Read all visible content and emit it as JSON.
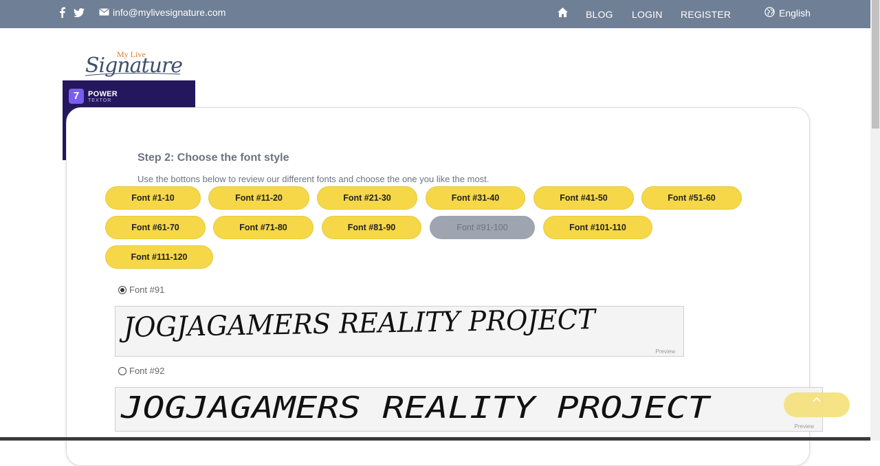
{
  "topbar": {
    "email": "info@mylivesignature.com",
    "nav": [
      "BLOG",
      "LOGIN",
      "REGISTER"
    ],
    "language": "English"
  },
  "logo": {
    "top": "My Live",
    "main": "Signature"
  },
  "ad": {
    "brand": "POWER",
    "sub": "TEXTOR"
  },
  "step": {
    "title": "Step 2: Choose the font style",
    "description": "Use the bottons below to review our different fonts and choose the one you like the most."
  },
  "font_buttons": [
    "Font #1-10",
    "Font #11-20",
    "Font #21-30",
    "Font #31-40",
    "Font #41-50",
    "Font #51-60",
    "Font #61-70",
    "Font #71-80",
    "Font #81-90",
    "Font #91-100",
    "Font #101-110",
    "Font #111-120"
  ],
  "active_font_button": "Font #91-100",
  "fonts": [
    {
      "label": "Font #91",
      "selected": true,
      "preview_text": "JOGJAGAMERS REALITY PROJECT",
      "preview_label": "Preview"
    },
    {
      "label": "Font #92",
      "selected": false,
      "preview_text": "JOGJAGAMERS REALITY PROJECT",
      "preview_label": "Preview"
    }
  ],
  "colors": {
    "topbar": "#6f7f95",
    "button": "#f5d748",
    "button_active": "#9ea5b1",
    "ad_bg": "#25175e"
  }
}
